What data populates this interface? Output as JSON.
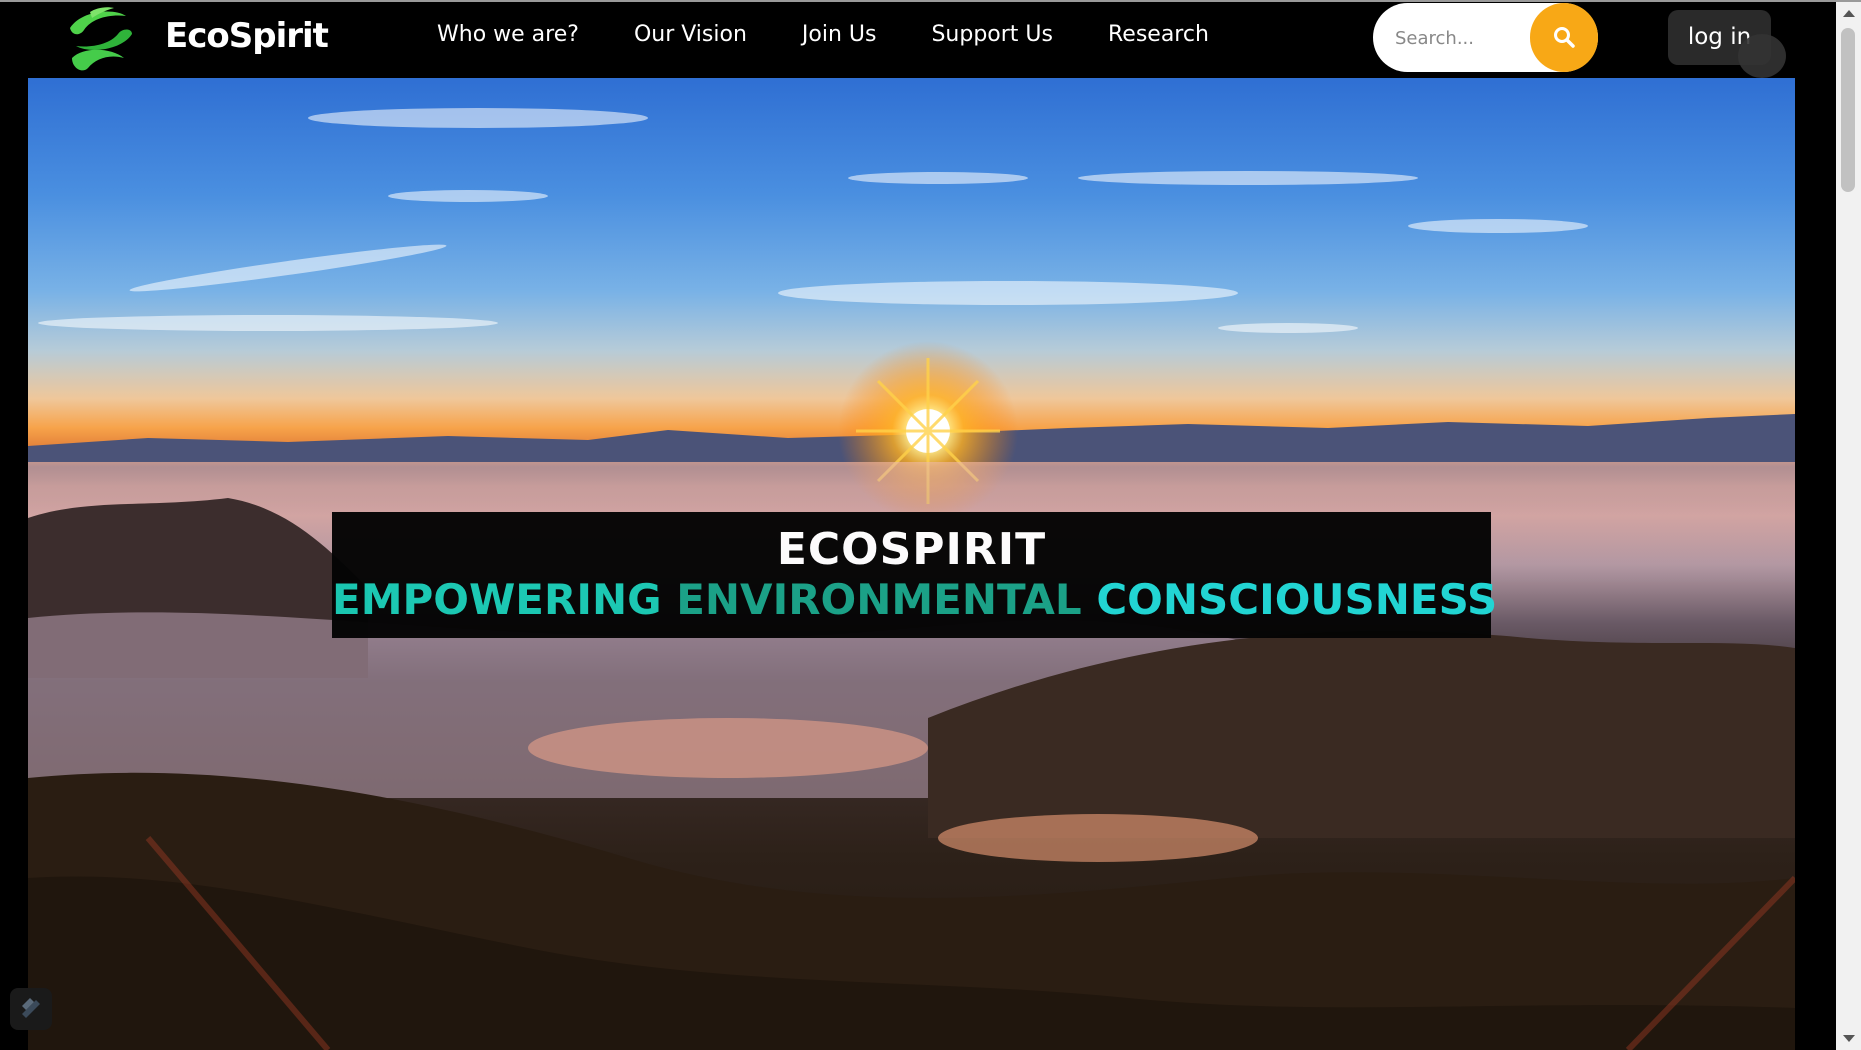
{
  "header": {
    "brand": "EcoSpirit",
    "logo_icon": "leaf-swirl-icon",
    "nav": [
      {
        "label": "Who we are?"
      },
      {
        "label": "Our Vision"
      },
      {
        "label": "Join Us"
      },
      {
        "label": "Support Us"
      },
      {
        "label": "Research"
      }
    ],
    "search": {
      "placeholder": "Search...",
      "button_icon": "search-icon"
    },
    "login_label": "log in"
  },
  "hero": {
    "title": "ECOSPIRIT",
    "subtitle_words": [
      "EMPOWERING",
      "ENVIRONMENTAL",
      "CONSCIOUSNESS"
    ]
  },
  "colors": {
    "accent_orange": "#f8a816",
    "teal_1": "#19cbb5",
    "teal_2": "#18a388",
    "teal_3": "#1fd8d6",
    "logo_green": "#3cc43a"
  }
}
